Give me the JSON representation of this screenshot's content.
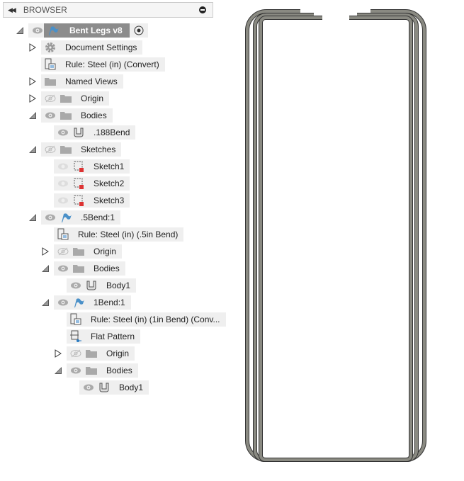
{
  "browser": {
    "title": "BROWSER",
    "collapse_icon": "double-chevron-left-icon",
    "minimize_icon": "minus-circle-icon"
  },
  "tree": [
    {
      "label": "Bent Legs v8",
      "icon": "component-flag-icon",
      "eye": "visible",
      "toggle": "expanded",
      "level": 0,
      "active": true
    },
    {
      "label": "Document Settings",
      "icon": "gear-icon",
      "toggle": "collapsed",
      "level": 1
    },
    {
      "label": "Rule: Steel (in) (Convert)",
      "icon": "sheet-metal-rule-icon",
      "level": 1
    },
    {
      "label": "Named Views",
      "icon": "folder-icon",
      "toggle": "collapsed",
      "level": 1
    },
    {
      "label": "Origin",
      "icon": "folder-icon",
      "eye": "hidden",
      "toggle": "collapsed",
      "level": 1
    },
    {
      "label": "Bodies",
      "icon": "folder-icon",
      "eye": "visible",
      "toggle": "expanded",
      "level": 1
    },
    {
      "label": ".188Bend",
      "icon": "sheet-metal-body-icon",
      "eye": "visible",
      "level": 2
    },
    {
      "label": "Sketches",
      "icon": "folder-icon",
      "eye": "hidden",
      "toggle": "expanded",
      "level": 1
    },
    {
      "label": "Sketch1",
      "icon": "sketch-icon",
      "eye": "faded",
      "level": 2
    },
    {
      "label": "Sketch2",
      "icon": "sketch-icon",
      "eye": "faded",
      "level": 2
    },
    {
      "label": "Sketch3",
      "icon": "sketch-icon",
      "eye": "faded",
      "level": 2
    },
    {
      "label": ".5Bend:1",
      "icon": "component-flag-icon",
      "eye": "visible",
      "toggle": "expanded",
      "level": 1
    },
    {
      "label": "Rule: Steel (in) (.5in Bend)",
      "icon": "sheet-metal-rule-icon",
      "level": 2
    },
    {
      "label": "Origin",
      "icon": "folder-icon",
      "eye": "hidden",
      "toggle": "collapsed",
      "level": 2
    },
    {
      "label": "Bodies",
      "icon": "folder-icon",
      "eye": "visible",
      "toggle": "expanded",
      "level": 2
    },
    {
      "label": "Body1",
      "icon": "sheet-metal-body-icon",
      "eye": "visible",
      "level": 3
    },
    {
      "label": "1Bend:1",
      "icon": "component-flag-icon",
      "eye": "visible",
      "toggle": "expanded",
      "level": 2
    },
    {
      "label": "Rule: Steel (in) (1in Bend) (Conv...",
      "icon": "sheet-metal-rule-icon",
      "level": 3
    },
    {
      "label": "Flat Pattern",
      "icon": "flat-pattern-icon",
      "level": 3
    },
    {
      "label": "Origin",
      "icon": "folder-icon",
      "eye": "hidden",
      "toggle": "collapsed",
      "level": 3
    },
    {
      "label": "Bodies",
      "icon": "folder-icon",
      "eye": "visible",
      "toggle": "expanded",
      "level": 3
    },
    {
      "label": "Body1",
      "icon": "sheet-metal-body-icon",
      "eye": "visible",
      "level": 4
    }
  ],
  "colors": {
    "metal": "#8a8a82",
    "metal_edge": "#333333",
    "selection": "#8c8c8c",
    "flag": "#4a90c8"
  }
}
